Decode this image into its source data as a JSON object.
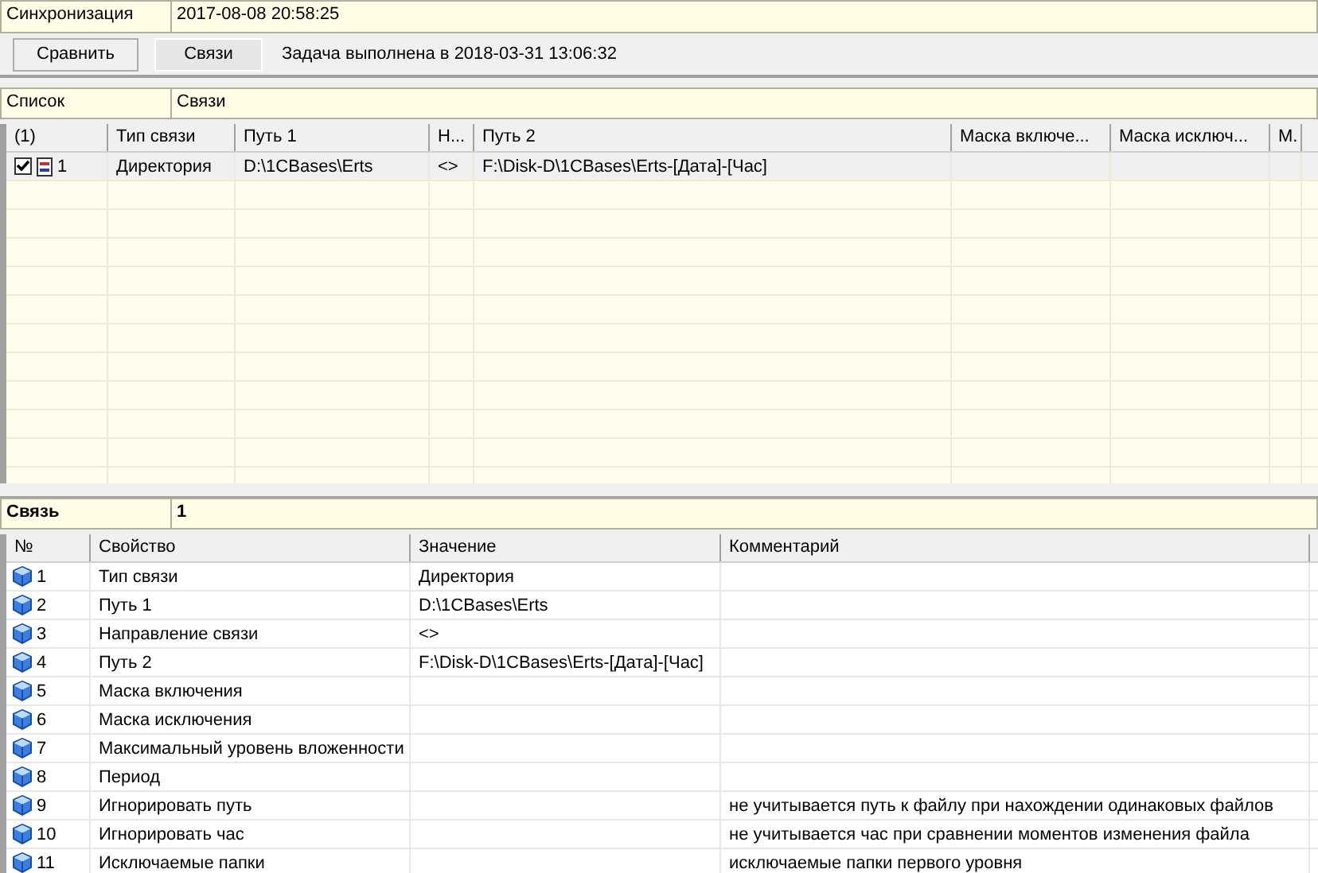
{
  "header": {
    "label": "Синхронизация",
    "value": "2017-08-08 20:58:25"
  },
  "toolbar": {
    "buttons": [
      {
        "label": "Сравнить",
        "selected": false
      },
      {
        "label": "Связи",
        "selected": true
      }
    ],
    "status": "Задача выполнена в 2018-03-31 13:06:32"
  },
  "list_bar": {
    "label": "Список",
    "value": "Связи"
  },
  "links_table": {
    "columns": [
      "(1)",
      "Тип связи",
      "Путь 1",
      "Н...",
      "Путь 2",
      "Маска включе...",
      "Маска исключ...",
      "М."
    ],
    "rows": [
      {
        "checked": true,
        "selected": true,
        "cells": [
          "1",
          "Директория",
          "D:\\1CBases\\Erts",
          "<>",
          "F:\\Disk-D\\1CBases\\Erts-[Дата]-[Час]",
          "",
          "",
          ""
        ]
      }
    ]
  },
  "detail_bar": {
    "label": "Связь",
    "value": "1"
  },
  "properties_table": {
    "columns": [
      "№",
      "Свойство",
      "Значение",
      "Комментарий"
    ],
    "rows": [
      [
        "1",
        "Тип связи",
        "Директория",
        ""
      ],
      [
        "2",
        "Путь 1",
        "D:\\1CBases\\Erts",
        ""
      ],
      [
        "3",
        "Направление связи",
        "<>",
        ""
      ],
      [
        "4",
        "Путь 2",
        "F:\\Disk-D\\1CBases\\Erts-[Дата]-[Час]",
        ""
      ],
      [
        "5",
        "Маска включения",
        "",
        ""
      ],
      [
        "6",
        "Маска исключения",
        "",
        ""
      ],
      [
        "7",
        "Максимальный уровень вложенности",
        "",
        ""
      ],
      [
        "8",
        "Период",
        "",
        ""
      ],
      [
        "9",
        "Игнорировать путь",
        "",
        "не учитывается путь к файлу при нахождении одинаковых файлов"
      ],
      [
        "10",
        "Игнорировать час",
        "",
        "не учитывается час при сравнении моментов изменения файла"
      ],
      [
        "11",
        "Исключаемые папки",
        "",
        "исключаемые папки первого уровня"
      ]
    ]
  }
}
